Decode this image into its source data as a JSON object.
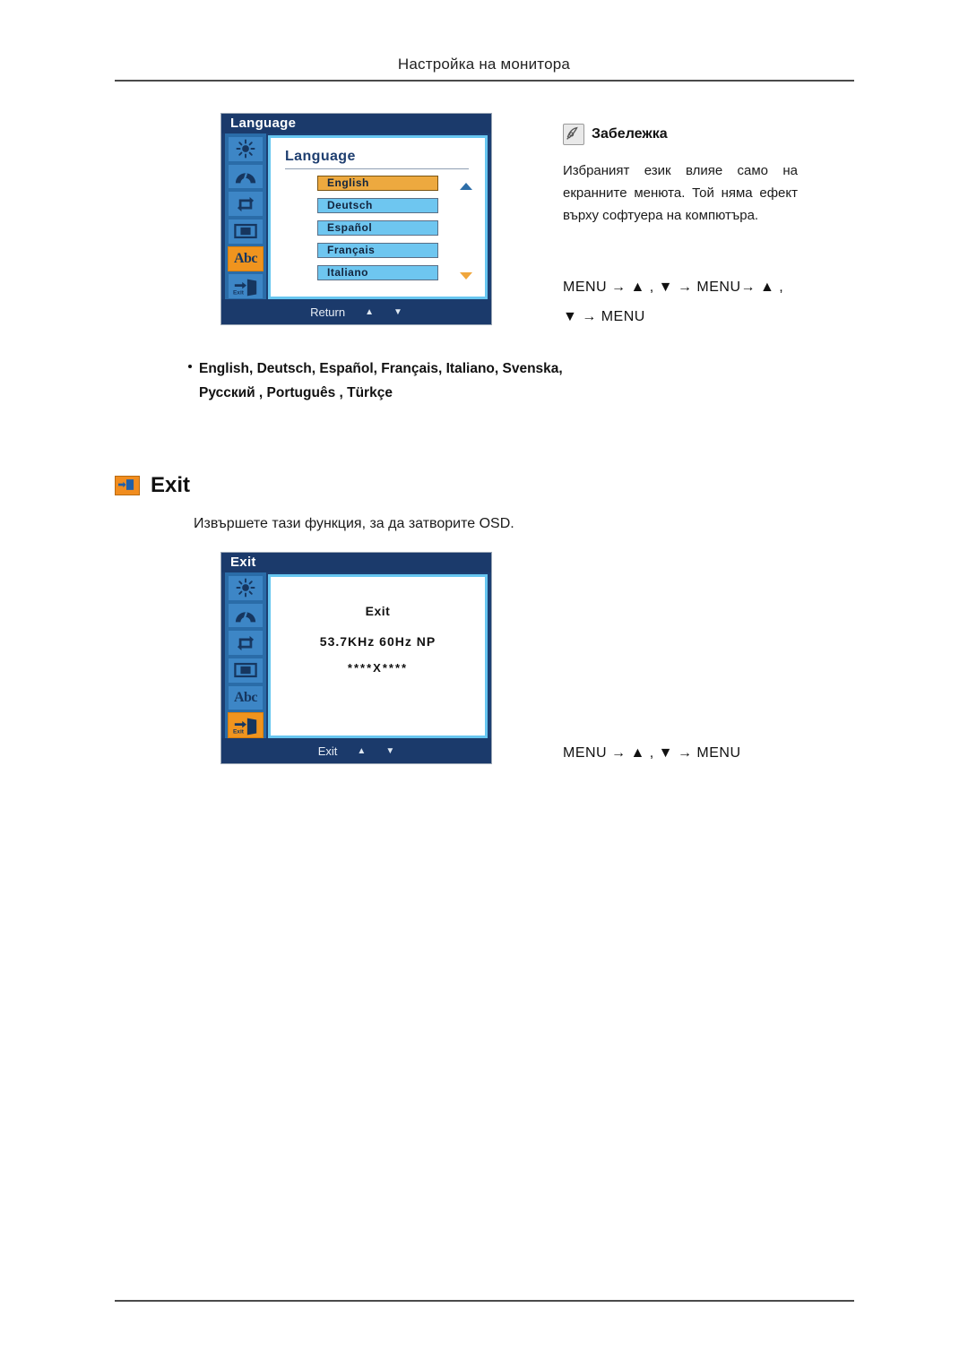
{
  "page": {
    "header_title": "Настройка на монитора"
  },
  "language_osd": {
    "titlebar": "Language",
    "panel_heading": "Language",
    "options": [
      {
        "label": "English",
        "selected": true
      },
      {
        "label": "Deutsch",
        "selected": false
      },
      {
        "label": "Español",
        "selected": false
      },
      {
        "label": "Français",
        "selected": false
      },
      {
        "label": "Italiano",
        "selected": false
      }
    ],
    "footer_label": "Return",
    "footer_up": "▲",
    "footer_down": "▼",
    "sidebar_icons": [
      "brightness-icon",
      "contrast-icon",
      "reset-icon",
      "image-size-icon",
      "language-abc-icon",
      "exit-door-icon"
    ],
    "sidebar_active_index": 4,
    "abc_icon_label": "Abc",
    "exit_icon_label": "Exit"
  },
  "note": {
    "title": "Забележка",
    "body": "Избраният език влияе само на екранните менюта. Той няма ефект върху софтуера на компютъра.",
    "keys_line_1": "MENU → ▲ , ▼ → MENU→ ▲ ,",
    "keys_line_2": "▼ → MENU"
  },
  "language_list_bullet": {
    "line_1": "English, Deutsch, Español, Français,  Italiano, Svenska,",
    "line_2": "Русский , Português , Türkçe"
  },
  "exit_section": {
    "title": "Exit",
    "description": "Извършете тази функция, за да затворите OSD.",
    "keys": "MENU → ▲ , ▼ → MENU"
  },
  "exit_osd": {
    "titlebar": "Exit",
    "line_1": "Exit",
    "line_2": "53.7KHz 60Hz NP",
    "line_3": "****X****",
    "footer_label": "Exit",
    "footer_up": "▲",
    "footer_down": "▼",
    "sidebar_active_index": 5,
    "abc_icon_label": "Abc",
    "exit_icon_label": "Exit"
  },
  "colors": {
    "osd_navy": "#1b3a6b",
    "osd_sidebar_blue": "#2a6ca8",
    "osd_icon_blue": "#3d86c6",
    "osd_highlight_orange": "#f0941e",
    "option_blue": "#6ec6f0",
    "option_selected": "#eda93f",
    "screen_border": "#67c6f0"
  }
}
